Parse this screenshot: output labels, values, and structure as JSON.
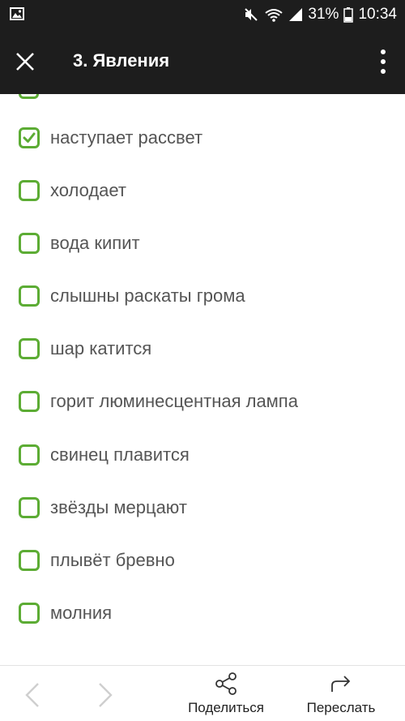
{
  "status_bar": {
    "left_icon": "image-icon",
    "right_icons": [
      "mute-icon",
      "wifi-icon",
      "signal-icon"
    ],
    "battery_percent": "31%",
    "time": "10:34"
  },
  "app_bar": {
    "title": "3. Явления",
    "close_icon": "close-icon",
    "menu_icon": "more-vert-icon"
  },
  "accent_color": "#5cac34",
  "items": [
    {
      "label": "наступает рассвет",
      "checked": true
    },
    {
      "label": "холодает",
      "checked": false
    },
    {
      "label": "вода кипит",
      "checked": false
    },
    {
      "label": "слышны раскаты грома",
      "checked": false
    },
    {
      "label": "шар катится",
      "checked": false
    },
    {
      "label": "горит люминесцентная лампа",
      "checked": false
    },
    {
      "label": "свинец плавится",
      "checked": false
    },
    {
      "label": "звёзды мерцают",
      "checked": false
    },
    {
      "label": "плывёт бревно",
      "checked": false
    },
    {
      "label": "молния",
      "checked": false
    }
  ],
  "bottom_bar": {
    "back_icon": "chevron-left-icon",
    "forward_icon": "chevron-right-icon",
    "share_label": "Поделиться",
    "forward_label": "Переслать"
  }
}
